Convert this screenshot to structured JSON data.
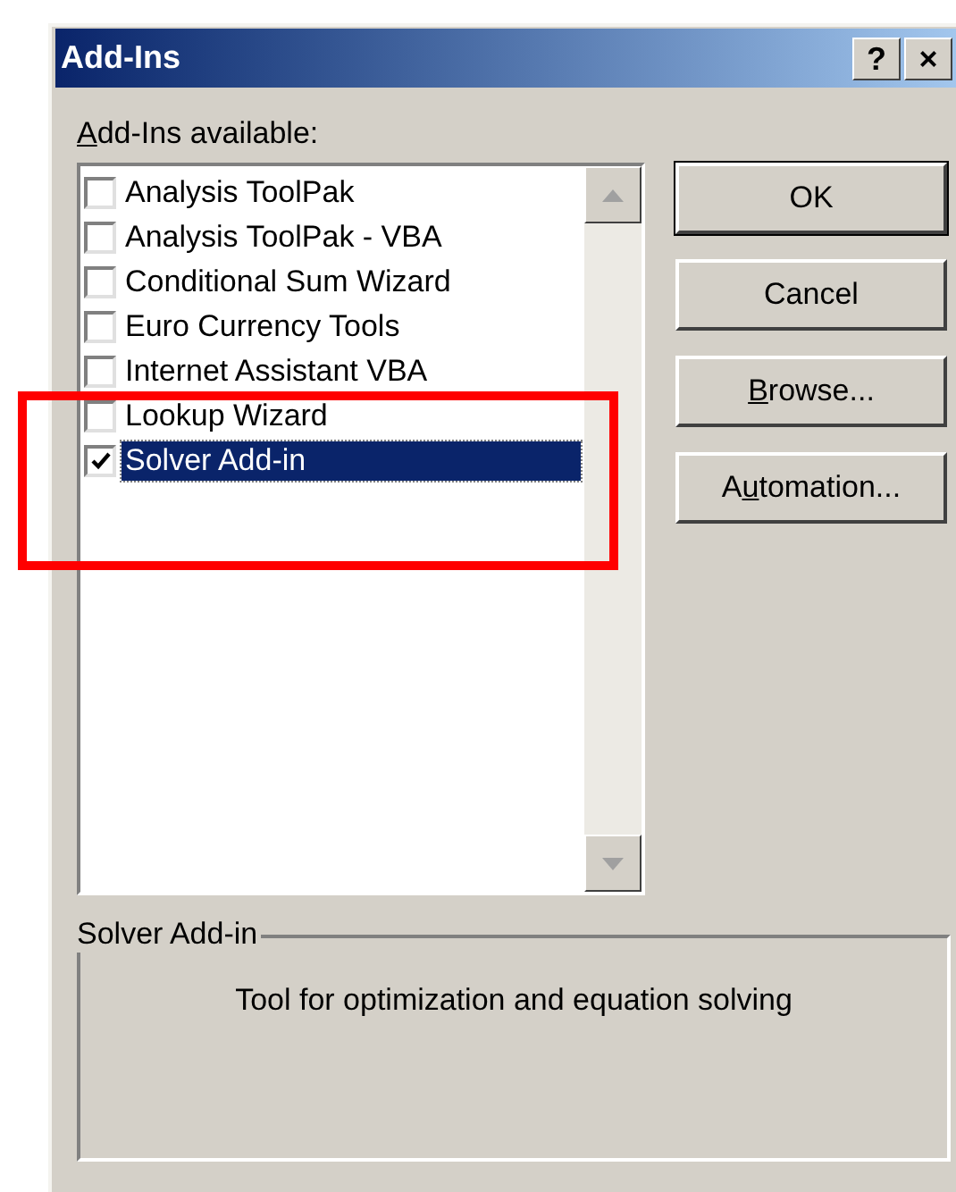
{
  "window": {
    "title": "Add-Ins",
    "title_buttons": [
      "?",
      "×"
    ]
  },
  "list_label": {
    "key": "A",
    "after": "dd-Ins available:"
  },
  "addins": [
    {
      "name": "Analysis ToolPak",
      "checked": false,
      "selected": false
    },
    {
      "name": "Analysis ToolPak - VBA",
      "checked": false,
      "selected": false
    },
    {
      "name": "Conditional Sum Wizard",
      "checked": false,
      "selected": false
    },
    {
      "name": "Euro Currency Tools",
      "checked": false,
      "selected": false
    },
    {
      "name": "Internet Assistant VBA",
      "checked": false,
      "selected": false
    },
    {
      "name": "Lookup Wizard",
      "checked": false,
      "selected": false
    },
    {
      "name": "Solver Add-in",
      "checked": true,
      "selected": true
    }
  ],
  "buttons": [
    {
      "before": "OK",
      "kind": "default"
    },
    {
      "before": "Cancel",
      "kind": "normal"
    },
    {
      "key": "B",
      "after": "rowse...",
      "kind": "normal"
    },
    {
      "before": "A",
      "key": "u",
      "after": "tomation...",
      "kind": "normal"
    }
  ],
  "details": {
    "legend": "Solver Add-in",
    "description": "Tool for optimization and equation solving"
  }
}
